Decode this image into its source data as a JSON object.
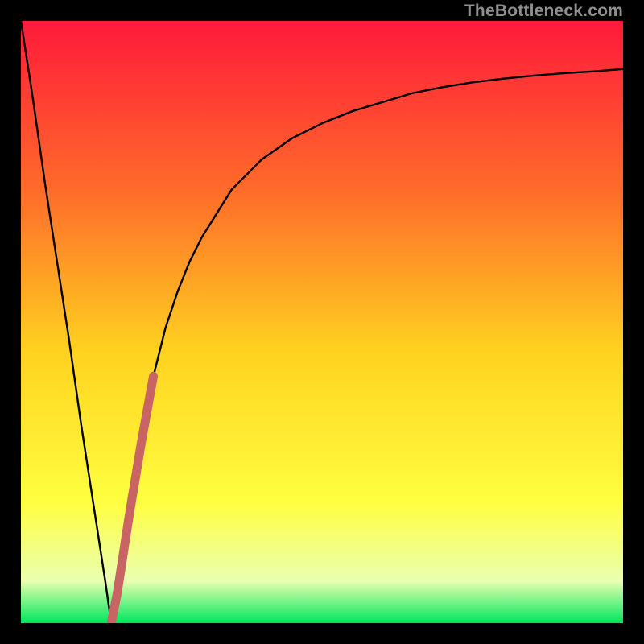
{
  "watermark": "TheBottleneck.com",
  "colors": {
    "frame": "#000000",
    "gradient_top": "#ff1a3a",
    "gradient_upper_mid": "#ff6a2a",
    "gradient_mid": "#ffd21f",
    "gradient_lower_mid": "#ffff40",
    "gradient_near_bottom": "#eaffb0",
    "gradient_bottom": "#00e65e",
    "curve": "#000000",
    "highlight": "#c86464"
  },
  "chart_data": {
    "type": "line",
    "title": "",
    "xlabel": "",
    "ylabel": "",
    "xlim": [
      0,
      100
    ],
    "ylim": [
      0,
      100
    ],
    "grid": false,
    "series": [
      {
        "name": "bottleneck-curve",
        "x": [
          0,
          2,
          4,
          6,
          8,
          10,
          12,
          14,
          15,
          16,
          18,
          20,
          22,
          24,
          26,
          28,
          30,
          35,
          40,
          45,
          50,
          55,
          60,
          65,
          70,
          75,
          80,
          85,
          90,
          95,
          100
        ],
        "values": [
          100,
          87,
          73,
          60,
          47,
          33,
          20,
          7,
          0,
          5,
          18,
          30,
          41,
          49,
          55,
          60,
          64,
          72,
          77,
          80.5,
          83,
          85,
          86.5,
          88,
          89,
          89.8,
          90.4,
          90.9,
          91.3,
          91.6,
          92
        ]
      },
      {
        "name": "highlight-segment",
        "x": [
          15,
          16,
          18,
          20,
          22
        ],
        "values": [
          0,
          5,
          18,
          30,
          41
        ]
      }
    ],
    "annotations": []
  }
}
